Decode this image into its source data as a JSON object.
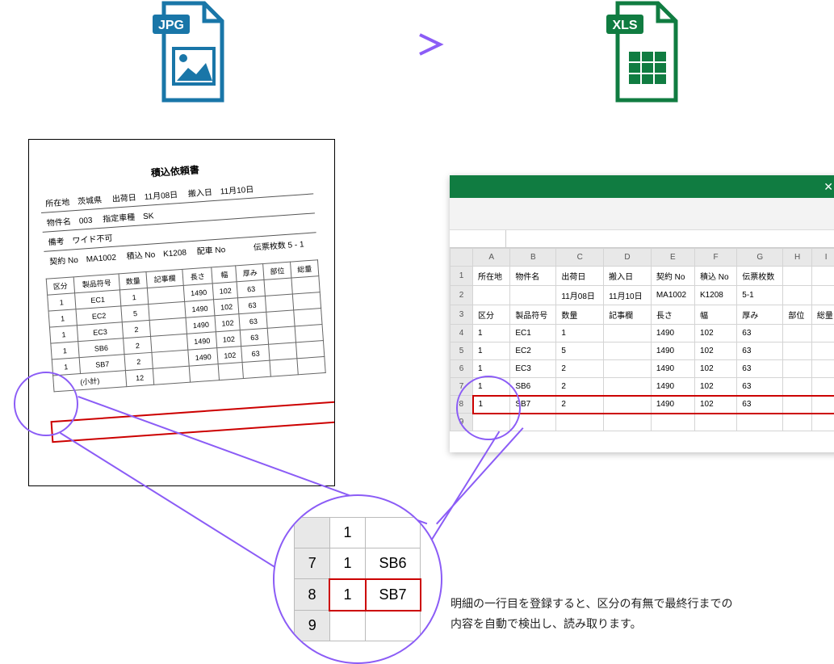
{
  "icons": {
    "jpg_label": "JPG",
    "xls_label": "XLS"
  },
  "jpg_doc": {
    "title": "積込依頼書",
    "header": {
      "line1": {
        "k1": "所在地",
        "v1": "茨城県",
        "k2": "出荷日",
        "v2": "11月08日",
        "k3": "搬入日",
        "v3": "11月10日"
      },
      "line2": {
        "k1": "物件名",
        "v1": "003",
        "k2": "指定車種",
        "v2": "SK"
      },
      "line3": {
        "k1": "備考",
        "v1": "ワイド不可"
      },
      "line4": {
        "k1": "契約 No",
        "v1": "MA1002",
        "k2": "積込 No",
        "v2": "K1208",
        "k3": "配車 No",
        "k4": "伝票枚数 5 - 1"
      }
    },
    "columns": [
      "区分",
      "製品符号",
      "数量",
      "記事欄",
      "長さ",
      "幅",
      "厚み",
      "部位",
      "総量"
    ],
    "rows": [
      {
        "c": [
          "1",
          "EC1",
          "1",
          "",
          "1490",
          "102",
          "63",
          "",
          ""
        ]
      },
      {
        "c": [
          "1",
          "EC2",
          "5",
          "",
          "1490",
          "102",
          "63",
          "",
          ""
        ]
      },
      {
        "c": [
          "1",
          "EC3",
          "2",
          "",
          "1490",
          "102",
          "63",
          "",
          ""
        ]
      },
      {
        "c": [
          "1",
          "SB6",
          "2",
          "",
          "1490",
          "102",
          "63",
          "",
          ""
        ]
      },
      {
        "c": [
          "1",
          "SB7",
          "2",
          "",
          "1490",
          "102",
          "63",
          "",
          ""
        ]
      }
    ],
    "subtotal_label": "(小計)",
    "subtotal_value": "12"
  },
  "excel": {
    "close": "✕",
    "col_headers": [
      "A",
      "B",
      "C",
      "D",
      "E",
      "F",
      "G",
      "H",
      "I"
    ],
    "rows": [
      {
        "n": "1",
        "c": [
          "所在地",
          "物件名",
          "出荷日",
          "搬入日",
          "契約 No",
          "積込 No",
          "伝票枚数",
          "",
          ""
        ]
      },
      {
        "n": "2",
        "c": [
          "",
          "",
          "11月08日",
          "11月10日",
          "MA1002",
          "K1208",
          "5-1",
          "",
          ""
        ]
      },
      {
        "n": "3",
        "c": [
          "区分",
          "製品符号",
          "数量",
          "記事欄",
          "長さ",
          "幅",
          "厚み",
          "部位",
          "総量"
        ]
      },
      {
        "n": "4",
        "c": [
          "1",
          "EC1",
          "1",
          "",
          "1490",
          "102",
          "63",
          "",
          ""
        ]
      },
      {
        "n": "5",
        "c": [
          "1",
          "EC2",
          "5",
          "",
          "1490",
          "102",
          "63",
          "",
          ""
        ]
      },
      {
        "n": "6",
        "c": [
          "1",
          "EC3",
          "2",
          "",
          "1490",
          "102",
          "63",
          "",
          ""
        ]
      },
      {
        "n": "7",
        "c": [
          "1",
          "SB6",
          "2",
          "",
          "1490",
          "102",
          "63",
          "",
          ""
        ]
      },
      {
        "n": "8",
        "c": [
          "1",
          "SB7",
          "2",
          "",
          "1490",
          "102",
          "63",
          "",
          ""
        ]
      },
      {
        "n": "9",
        "c": [
          "",
          "",
          "",
          "",
          "",
          "",
          "",
          "",
          ""
        ]
      }
    ],
    "highlight_row": 8
  },
  "zoom": {
    "rows": [
      {
        "n": "",
        "c": [
          "1",
          ""
        ]
      },
      {
        "n": "7",
        "c": [
          "1",
          "SB6"
        ]
      },
      {
        "n": "8",
        "c": [
          "1",
          "SB7"
        ]
      },
      {
        "n": "9",
        "c": [
          "",
          ""
        ]
      }
    ],
    "highlight_row": 2
  },
  "caption": {
    "line1": "明細の一行目を登録すると、区分の有無で最終行までの",
    "line2": "内容を自動で検出し、読み取ります。"
  }
}
